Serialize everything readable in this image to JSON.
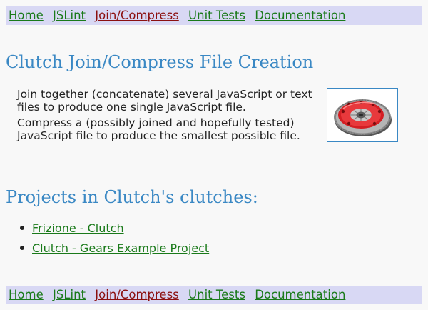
{
  "nav": {
    "items": [
      {
        "label": "Home"
      },
      {
        "label": "JSLint"
      },
      {
        "label": "Join/Compress",
        "current": true
      },
      {
        "label": "Unit Tests"
      },
      {
        "label": "Documentation"
      }
    ]
  },
  "page": {
    "title": "Clutch Join/Compress File Creation",
    "intro_1": "Join together (concatenate) several JavaScript or text files to produce one single JavaScript file.",
    "intro_2": "Compress a (possibly joined and hopefully tested) JavaScript file to produce the smallest possible file.",
    "image_icon": "clutch-image"
  },
  "projects": {
    "heading": "Projects in Clutch's clutches:",
    "items": [
      {
        "label": "Frizione - Clutch"
      },
      {
        "label": "Clutch - Gears Example Project"
      }
    ]
  },
  "colors": {
    "nav_background": "#d8d8f4",
    "link": "#1a7a1a",
    "current_link": "#8c1010",
    "heading": "#3a88c4",
    "page_background": "#f8f8f8"
  }
}
